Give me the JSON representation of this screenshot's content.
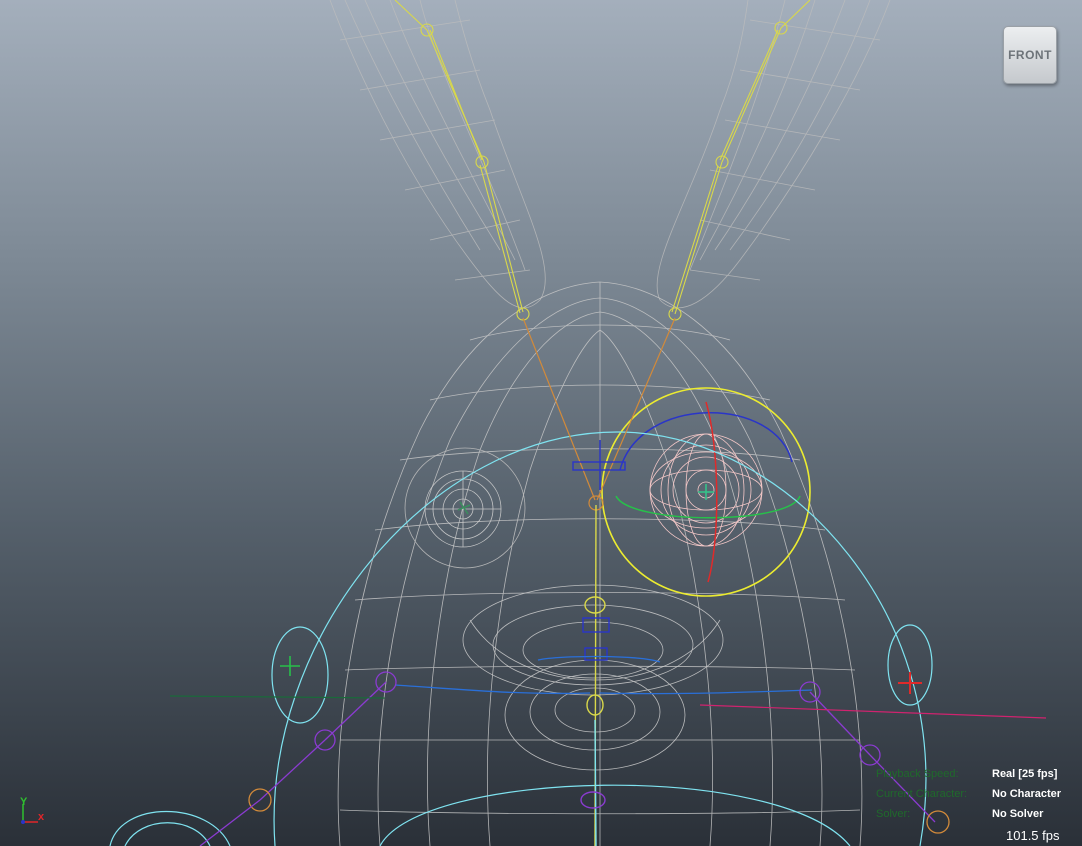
{
  "viewport": {
    "camera_label": "FRONT",
    "hud": {
      "rows": [
        {
          "label": "Playback Speed:",
          "value": "Real [25 fps]"
        },
        {
          "label": "Current Character:",
          "value": "No Character"
        },
        {
          "label": "Solver:",
          "value": "No Solver"
        }
      ],
      "frame_rate": "101.5 fps"
    },
    "axis": {
      "x": "x",
      "y": "Y"
    },
    "colors": {
      "wireframe": "#c9c9c9",
      "joint_yellow": "#d9d84a",
      "joint_orange": "#d28a3a",
      "selection_circle": "#ecec30",
      "control_cyan": "#7fe3f0",
      "control_blue": "#2a35c8",
      "control_red": "#e02a2a",
      "control_green": "#27c04a",
      "ik_purple": "#8a3bd0"
    }
  }
}
